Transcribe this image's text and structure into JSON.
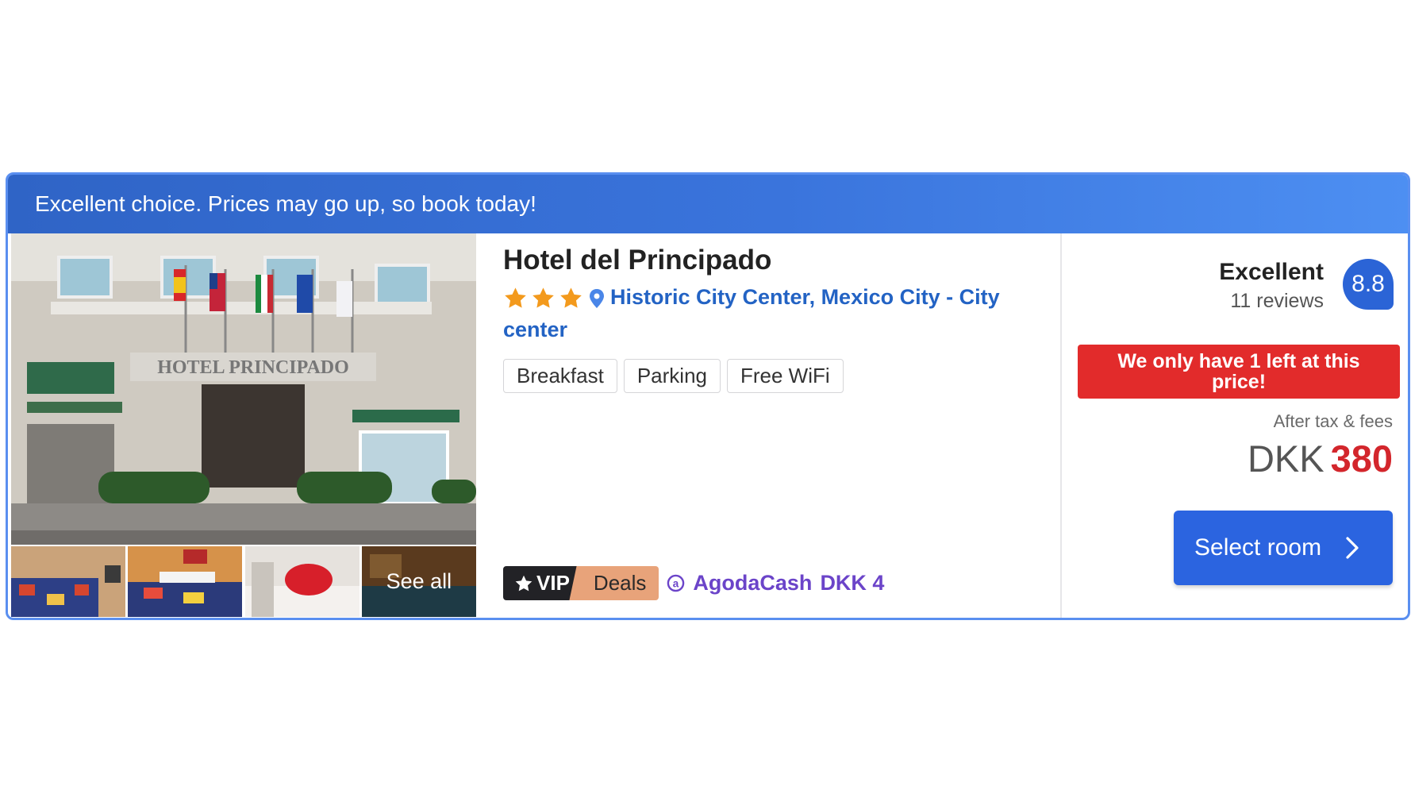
{
  "banner": {
    "text": "Excellent choice. Prices may go up, so book today!"
  },
  "hotel": {
    "name": "Hotel del Principado",
    "star_rating": 3,
    "location": "Historic City Center, Mexico City - City center",
    "amenities": [
      "Breakfast",
      "Parking",
      "Free WiFi"
    ],
    "photo_sign": "HOTEL PRINCIPADO"
  },
  "gallery": {
    "see_all": "See all"
  },
  "deals": {
    "vip": "VIP",
    "deals": "Deals",
    "cash_label": "AgodaCash",
    "cash_value": "DKK 4"
  },
  "rating": {
    "label": "Excellent",
    "reviews": "11 reviews",
    "score": "8.8"
  },
  "urgency": {
    "text": "We only have 1 left at this price!"
  },
  "pricing": {
    "tax_note": "After tax & fees",
    "currency": "DKK",
    "amount": "380"
  },
  "cta": {
    "select_room": "Select room"
  },
  "colors": {
    "accent": "#2b64e0",
    "banner": "#3a74dc",
    "urgency": "#e22b2b",
    "price": "#d3262c",
    "vip_deals": "#e8a37a",
    "cash": "#6b44c9"
  },
  "icons": [
    "star-icon",
    "location-pin-icon",
    "agodacash-icon",
    "chevron-right-icon"
  ]
}
